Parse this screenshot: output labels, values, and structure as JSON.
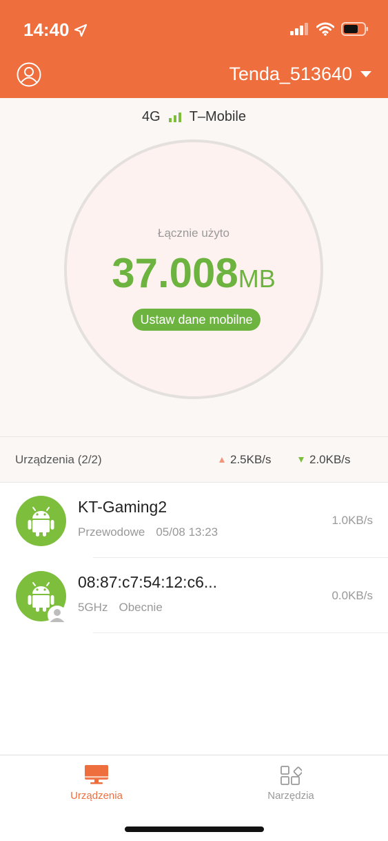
{
  "status_bar": {
    "time": "14:40"
  },
  "header": {
    "network_name": "Tenda_513640"
  },
  "carrier": {
    "network_type": "4G",
    "operator": "T–Mobile"
  },
  "usage": {
    "label": "Łącznie użyto",
    "value": "37.008",
    "unit": "MB",
    "button_label": "Ustaw dane mobilne"
  },
  "summary": {
    "title": "Urządzenia (2/2)",
    "upload": "2.5KB/s",
    "download": "2.0KB/s"
  },
  "devices": [
    {
      "name": "KT-Gaming2",
      "connection": "Przewodowe",
      "time": "05/08 13:23",
      "speed": "1.0KB/s"
    },
    {
      "name": "08:87:c7:54:12:c6...",
      "connection": "5GHz",
      "time": "Obecnie",
      "speed": "0.0KB/s"
    }
  ],
  "tabs": [
    {
      "label": "Urządzenia"
    },
    {
      "label": "Narzędzia"
    }
  ],
  "colors": {
    "accent": "#EE6E3E",
    "green": "#6DB33F"
  },
  "icons": [
    "location-arrow-icon",
    "cellular-signal-icon",
    "wifi-icon",
    "battery-icon",
    "user-account-icon",
    "android-icon",
    "monitor-icon",
    "tools-grid-icon"
  ]
}
